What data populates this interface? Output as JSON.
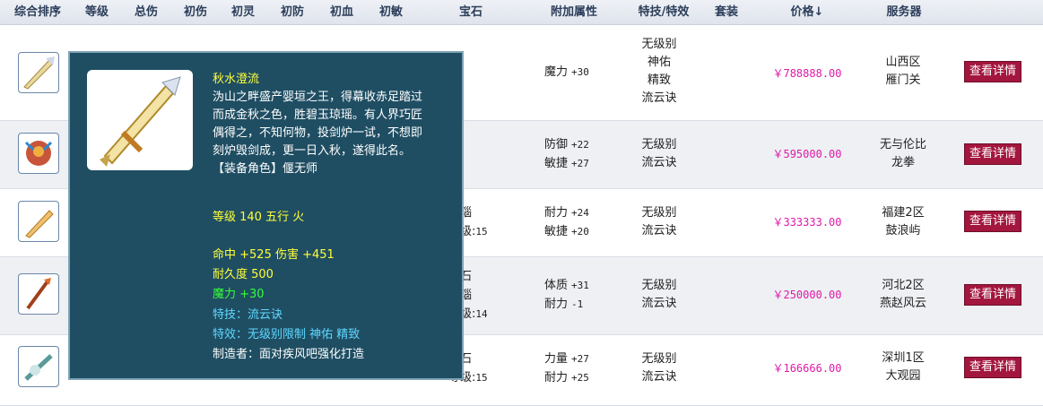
{
  "header": {
    "columns": [
      "综合排序",
      "等级",
      "总伤",
      "初伤",
      "初灵",
      "初防",
      "初血",
      "初敏",
      "宝石",
      "附加属性",
      "特技/特效",
      "套装",
      "价格↓",
      "服务器"
    ]
  },
  "rows": [
    {
      "gem": [],
      "attrs": [
        {
          "name": "魔力",
          "value": "+30"
        }
      ],
      "effects": [
        "无级别",
        "神佑",
        "精致",
        "流云诀"
      ],
      "price": "￥788888.00",
      "server": [
        "山西区",
        "雁门关"
      ],
      "button": "查看详情"
    },
    {
      "gem": [],
      "attrs": [
        {
          "name": "防御",
          "value": "+22"
        },
        {
          "name": "敏捷",
          "value": "+27"
        }
      ],
      "effects": [
        "无级别",
        "流云诀"
      ],
      "price": "￥595000.00",
      "server": [
        "无与伦比",
        "龙拳"
      ],
      "button": "查看详情"
    },
    {
      "gem": [
        {
          "text": "玛瑙"
        },
        {
          "text": "等级:",
          "value": "15"
        }
      ],
      "attrs": [
        {
          "name": "耐力",
          "value": "+24"
        },
        {
          "name": "敏捷",
          "value": "+20"
        }
      ],
      "effects": [
        "无级别",
        "流云诀"
      ],
      "price": "￥333333.00",
      "server": [
        "福建2区",
        "鼓浪屿"
      ],
      "button": "查看详情"
    },
    {
      "gem": [
        {
          "text": "阳石"
        },
        {
          "text": "玛瑙"
        },
        {
          "text": "等级:",
          "value": "14"
        }
      ],
      "attrs": [
        {
          "name": "体质",
          "value": "+31"
        },
        {
          "name": "耐力",
          "value": "-1"
        }
      ],
      "effects": [
        "无级别",
        "流云诀"
      ],
      "price": "￥250000.00",
      "server": [
        "河北2区",
        "燕赵风云"
      ],
      "button": "查看详情"
    },
    {
      "gem": [
        {
          "text": "阳石"
        },
        {
          "text": "等级:",
          "value": "15"
        }
      ],
      "attrs": [
        {
          "name": "力量",
          "value": "+27"
        },
        {
          "name": "耐力",
          "value": "+25"
        }
      ],
      "effects": [
        "无级别",
        "流云诀"
      ],
      "price": "￥166666.00",
      "server": [
        "深圳1区",
        "大观园"
      ],
      "button": "查看详情"
    }
  ],
  "tooltip": {
    "name": "秋水澄流",
    "desc": [
      "沩山之畔盛产婴垣之王，得幕收赤足踏过",
      "而成金秋之色，胜碧玉琼瑶。有人界巧匠",
      "偶得之，不知何物，投剑炉一试，不想即",
      "刻炉毁剑成，更一日入秋，遂得此名。"
    ],
    "role": "【装备角色】偃无师",
    "level_line": "等级 140 五行 火",
    "stats_line": "命中 +525 伤害 +451",
    "durability": "耐久度 500",
    "bonus": "魔力 +30",
    "skill": "特技：流云诀",
    "effect": "特效：无级别限制 神佑 精致",
    "maker": "制造者：面对疾风吧强化打造"
  },
  "colors": {
    "price": "#e01aa8",
    "button": "#a3163e",
    "tooltip_bg": "#1f4e63"
  }
}
